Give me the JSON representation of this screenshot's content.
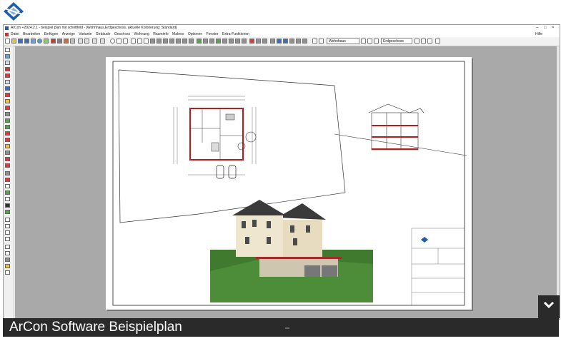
{
  "titlebar": {
    "title": "ArCon +2024.2.1 - beispiel plan mit schriftfeld - [Wohnhaus,Erdgeschoss, aktuelle Kolorierung: Standard]",
    "minimize": "–",
    "maximize": "□",
    "close": "×"
  },
  "menu": {
    "items": [
      "Datei",
      "Bearbeiten",
      "Einfügen",
      "Anzeige",
      "Variante",
      "Gebäude",
      "Geschoss",
      "Wohnung",
      "Rauminfo",
      "Makros",
      "Optionen",
      "Fenster",
      "Extra-Funktionen"
    ],
    "help": "Hilfe"
  },
  "toolbar": {
    "building_select": "Wohnhaus",
    "floor_select": "Erdgeschoss"
  },
  "caption": {
    "title": "ArCon Software Beispielplan"
  },
  "colors": {
    "brand_blue": "#1f5fa8",
    "caption_bg": "#2a2a2a",
    "canvas_bg": "#a9a9a9",
    "wall_red": "#b02020"
  },
  "icons": [
    "arcon-logo-icon",
    "chevron-down-icon"
  ]
}
